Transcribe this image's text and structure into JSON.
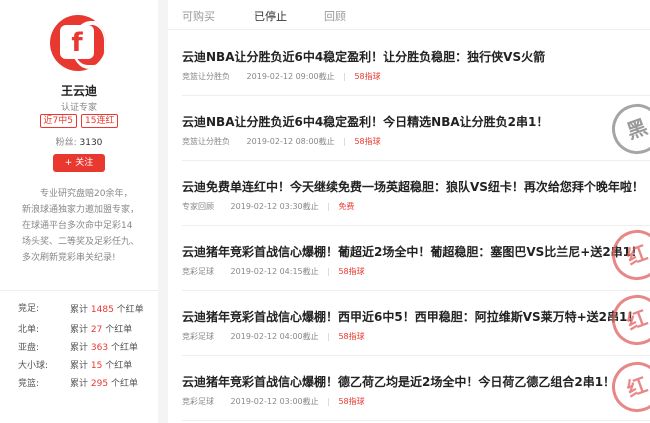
{
  "profile": {
    "name": "王云迪",
    "certification": "认证专家",
    "badges": [
      "近7中5",
      "15连红"
    ],
    "fans_label": "粉丝:",
    "fans_count": "3130",
    "follow_label": "+ 关注",
    "description": "专业研究盘赔20余年，新浪球通独家力邀加盟专家，在球通平台多次命中足彩14场头奖、二等奖及足彩任九、多次刷新竞彩串关纪录!"
  },
  "stats": [
    {
      "label": "竞足:",
      "prefix": "累计",
      "count": "1485",
      "suffix": "个红单"
    },
    {
      "label": "北单:",
      "prefix": "累计",
      "count": "27",
      "suffix": "个红单"
    },
    {
      "label": "亚盘:",
      "prefix": "累计",
      "count": "363",
      "suffix": "个红单"
    },
    {
      "label": "大小球:",
      "prefix": "累计",
      "count": "15",
      "suffix": "个红单"
    },
    {
      "label": "竞篮:",
      "prefix": "累计",
      "count": "295",
      "suffix": "个红单"
    }
  ],
  "tabs": [
    "可购买",
    "已停止",
    "回顾"
  ],
  "active_tab": "已停止",
  "items": [
    {
      "title": "云迪NBA让分胜负近6中4稳定盈利！让分胜负稳胆：独行侠VS火箭",
      "category": "竞篮让分胜负",
      "time": "2019-02-12 09:00截止",
      "price": "58指球",
      "stamp": ""
    },
    {
      "title": "云迪NBA让分胜负近6中4稳定盈利！今日精选NBA让分胜负2串1！",
      "category": "竞篮让分胜负",
      "time": "2019-02-12 08:00截止",
      "price": "58指球",
      "stamp": "黑"
    },
    {
      "title": "云迪免费单连红中！今天继续免费一场英超稳胆：狼队VS纽卡！再次给您拜个晚年啦！",
      "category": "专家回顾",
      "time": "2019-02-12 03:30截止",
      "price": "免费",
      "stamp": ""
    },
    {
      "title": "云迪猪年竞彩首战信心爆棚！葡超近2场全中！葡超稳胆：塞图巴VS比兰尼+送2串1！",
      "category": "竞彩足球",
      "time": "2019-02-12 04:15截止",
      "price": "58指球",
      "stamp": "红"
    },
    {
      "title": "云迪猪年竞彩首战信心爆棚！西甲近6中5！西甲稳胆：阿拉维斯VS莱万特+送2串1！",
      "category": "竞彩足球",
      "time": "2019-02-12 04:00截止",
      "price": "58指球",
      "stamp": "红"
    },
    {
      "title": "云迪猪年竞彩首战信心爆棚！德乙荷乙均是近2场全中！今日荷乙德乙组合2串1！",
      "category": "竞彩足球",
      "time": "2019-02-12 03:00截止",
      "price": "58指球",
      "stamp": "红"
    }
  ],
  "colors": {
    "accent": "#e8382f",
    "stamp_red": "#e06060",
    "stamp_black": "#777777"
  },
  "icons": {
    "avatar": "weibo-style-logo"
  }
}
